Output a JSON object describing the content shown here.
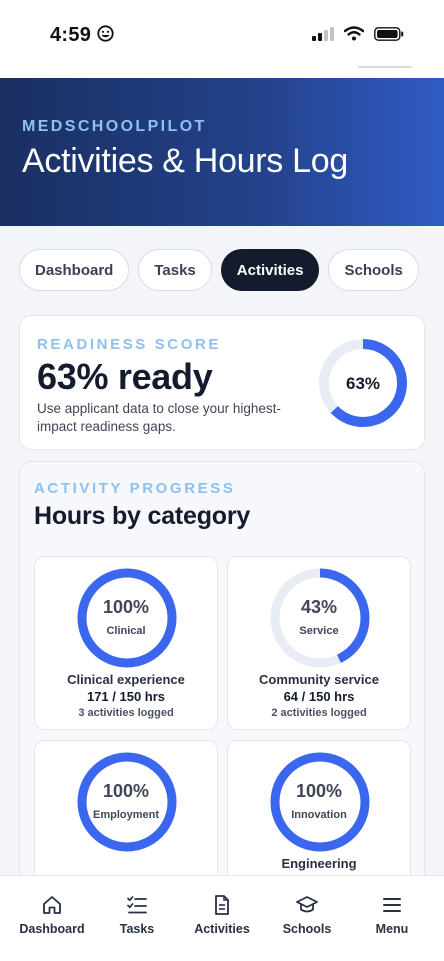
{
  "status_bar": {
    "time": "4:59"
  },
  "header": {
    "brand": "MEDSCHOOLPILOT",
    "title": "Activities & Hours Log"
  },
  "tabs": [
    {
      "label": "Dashboard",
      "active": false
    },
    {
      "label": "Tasks",
      "active": false
    },
    {
      "label": "Activities",
      "active": true
    },
    {
      "label": "Schools",
      "active": false
    }
  ],
  "readiness": {
    "overline": "READINESS SCORE",
    "value": "63% ready",
    "description": "Use applicant data to close your highest-impact readiness gaps.",
    "ring_label": "63%",
    "percent": 63
  },
  "activity_progress": {
    "overline": "ACTIVITY PROGRESS",
    "title": "Hours by category",
    "categories": [
      {
        "percent_label": "100%",
        "name": "Clinical",
        "label": "Clinical experience",
        "hours": "171 / 150 hrs",
        "logged": "3 activities logged",
        "percent": 100
      },
      {
        "percent_label": "43%",
        "name": "Service",
        "label": "Community service",
        "hours": "64 / 150 hrs",
        "logged": "2 activities logged",
        "percent": 43
      },
      {
        "percent_label": "100%",
        "name": "Employment",
        "label": "",
        "hours": "",
        "logged": "",
        "percent": 100
      },
      {
        "percent_label": "100%",
        "name": "Innovation",
        "label": "Engineering",
        "hours": "",
        "logged": "",
        "percent": 100
      }
    ]
  },
  "bottom_nav": [
    {
      "label": "Dashboard",
      "icon": "home-icon"
    },
    {
      "label": "Tasks",
      "icon": "checklist-icon"
    },
    {
      "label": "Activities",
      "icon": "document-icon"
    },
    {
      "label": "Schools",
      "icon": "graduation-cap-icon"
    },
    {
      "label": "Menu",
      "icon": "menu-icon"
    }
  ],
  "colors": {
    "accent": "#3a67ee",
    "track": "#e8ecf5",
    "header_dark": "#1a2f62",
    "brand_light": "#8fc0f2"
  }
}
